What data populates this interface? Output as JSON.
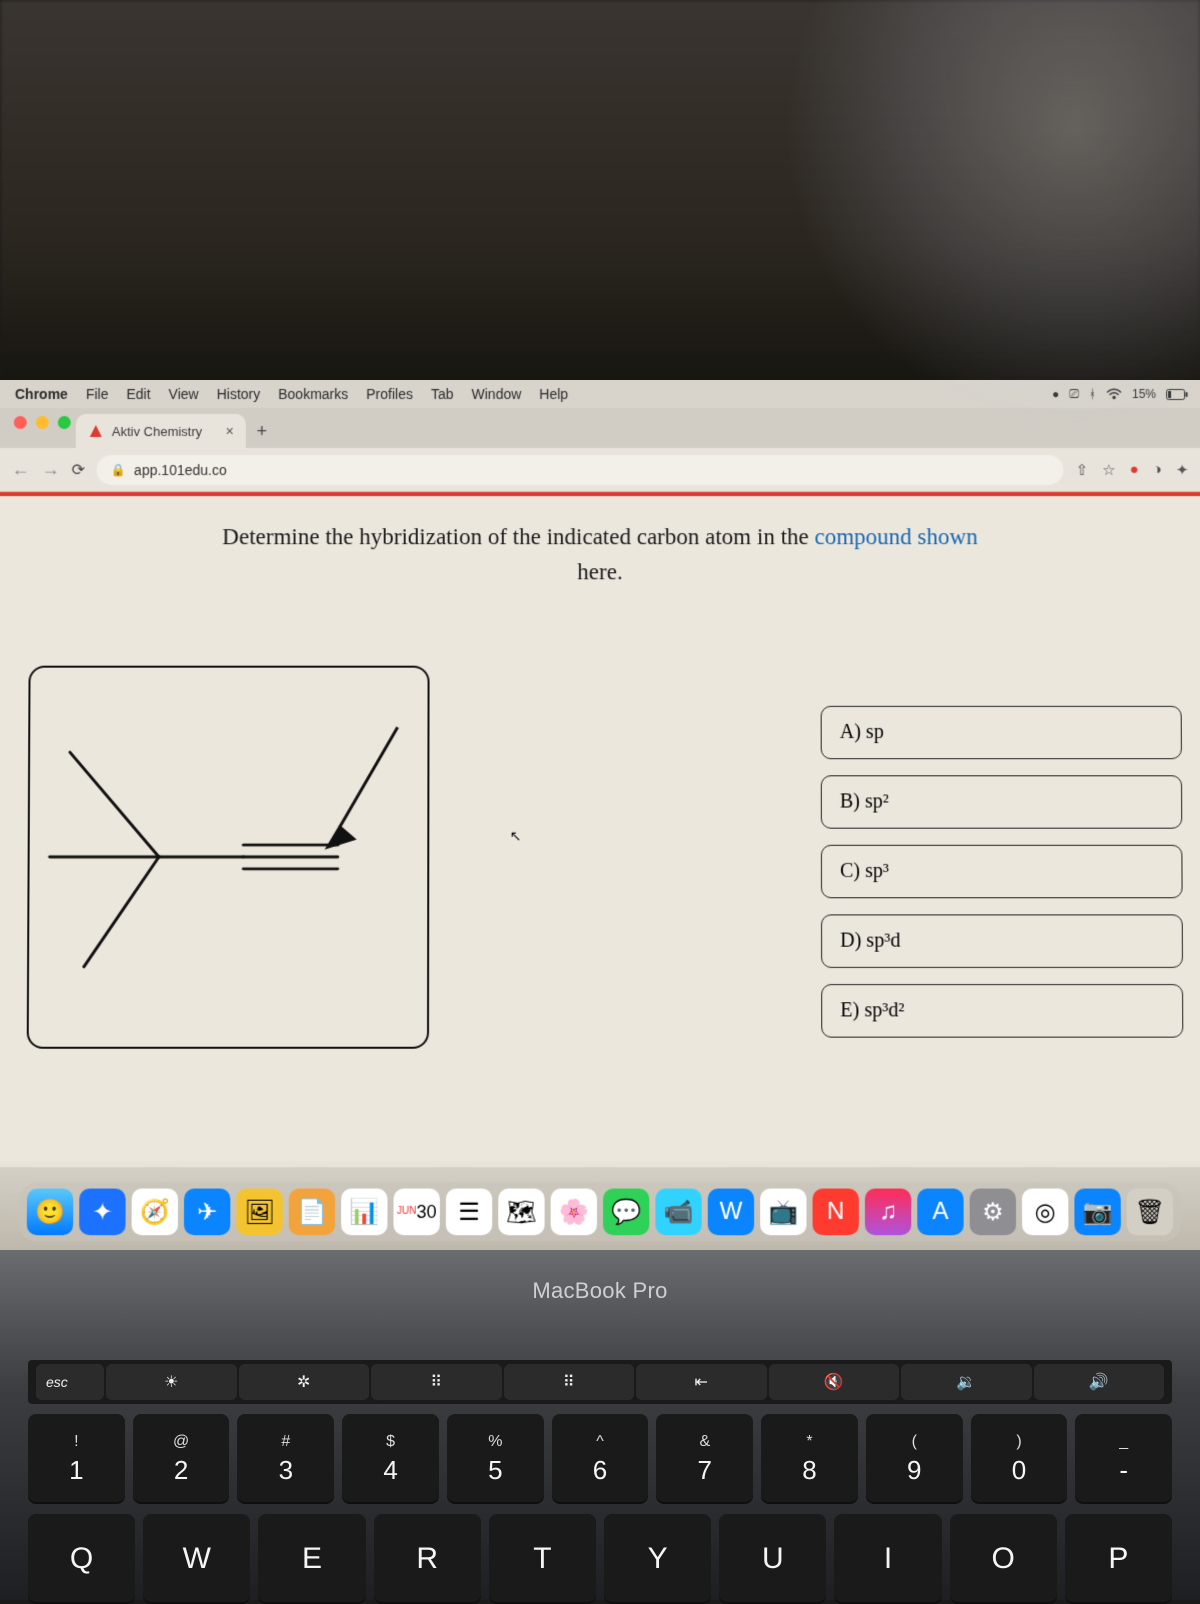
{
  "menubar": {
    "app": "Chrome",
    "items": [
      "File",
      "Edit",
      "View",
      "History",
      "Bookmarks",
      "Profiles",
      "Tab",
      "Window",
      "Help"
    ],
    "battery": "15%"
  },
  "tab": {
    "title": "Aktiv Chemistry",
    "close": "×"
  },
  "newtab": "+",
  "address": {
    "url": "app.101edu.co"
  },
  "question": {
    "line1_a": "Determine the hybridization of the indicated carbon atom in the ",
    "line1_b": "compound shown",
    "line2": "here."
  },
  "answers": [
    {
      "label": "A) sp"
    },
    {
      "label": "B) sp²"
    },
    {
      "label": "C) sp³"
    },
    {
      "label": "D) sp³d"
    },
    {
      "label": "E) sp³d²"
    }
  ],
  "hinge": "MacBook Pro",
  "touchbar": {
    "esc": "esc",
    "keys": [
      "☀︎",
      "✲",
      "⠿",
      "⠿",
      "⇤",
      "🔇",
      "🔉",
      "🔊"
    ]
  },
  "numrow": [
    {
      "u": "!",
      "l": "1"
    },
    {
      "u": "@",
      "l": "2"
    },
    {
      "u": "#",
      "l": "3"
    },
    {
      "u": "$",
      "l": "4"
    },
    {
      "u": "%",
      "l": "5"
    },
    {
      "u": "^",
      "l": "6"
    },
    {
      "u": "&",
      "l": "7"
    },
    {
      "u": "*",
      "l": "8"
    },
    {
      "u": "(",
      "l": "9"
    },
    {
      "u": ")",
      "l": "0"
    },
    {
      "u": "_",
      "l": "-"
    }
  ],
  "letterrow": [
    "Q",
    "W",
    "E",
    "R",
    "T",
    "Y",
    "U",
    "I",
    "O",
    "P"
  ]
}
